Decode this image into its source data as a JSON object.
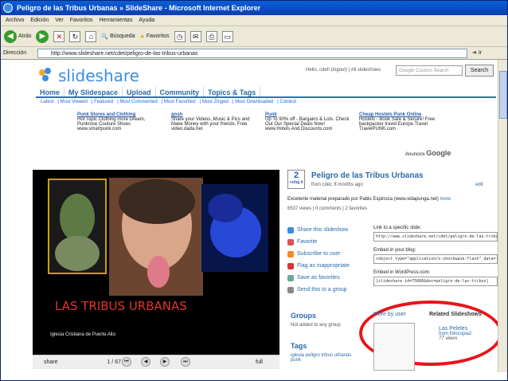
{
  "window": {
    "title": "Peligro de las Tribus Urbanas » SlideShare - Microsoft Internet Explorer"
  },
  "menu": [
    "Archivo",
    "Edición",
    "Ver",
    "Favoritos",
    "Herramientas",
    "Ayuda"
  ],
  "toolbar": {
    "back": "Atrás",
    "search": "Búsqueda",
    "favorites": "Favoritos"
  },
  "address": {
    "label": "Dirección",
    "url": "http://www.slideshare.net/cdet/peligro-de-las-tribus-urbanas",
    "go": "Ir"
  },
  "site": {
    "logo": "slideshare",
    "toplinks": "Hello, cdet! (logout) | All slideshows",
    "search_placeholder": "Google Custom Search",
    "search_button": "Search",
    "nav": [
      "Home",
      "My Slidespace",
      "Upload",
      "Community",
      "Topics & Tags"
    ],
    "subnav": [
      "Latest",
      "Most Viewed",
      "Featured",
      "Most Commented",
      "Most Favorited",
      "Most Zinged",
      "Most Downloaded",
      "Contest"
    ]
  },
  "ads": [
    {
      "title": "Punk Stores and Clothing",
      "text": "Hot Topic Clothing more Dream, Punkrose Couture Shoes",
      "url": "www.smartpunk.com"
    },
    {
      "title": "gosh",
      "text": "Share your Videos, Music & Pics and Make Money with your friends. Free",
      "url": "video.dada.net"
    },
    {
      "title": "Punk",
      "text": "Up To 90% off - Bargains & Lots. Check Out Our Special Deals Now!",
      "url": "www.Hotels And Discounts.com"
    },
    {
      "title": "Cheap Hostels Punk Online",
      "text": "Hostels - Book Safe & Secure! Free backpacker travel Europe Travel",
      "url": "TravelPUNK.com"
    }
  ],
  "ads_by": {
    "prefix": "Anuncios",
    "brand": "Google"
  },
  "video": {
    "title": "LAS TRIBUS URBANAS",
    "subtitle": "Iglesia Cristiana de Puerte Alto",
    "share": "share",
    "slide_counter": "1 / 67",
    "fullscreen": "full"
  },
  "info": {
    "zing_count": "2",
    "zing_label": "+zing it",
    "title": "Peligro de las Tribus Urbanas",
    "meta": "from cdet, 8 months ago",
    "edit": "edit",
    "description": "Excelente material preparado por Pablo Espinoza (www.vidapunga.net)",
    "more": "more",
    "views": "6537 views | 0 comments | 2 favorites",
    "actions": [
      "Share this slideshow",
      "Favorite",
      "Subscribe to user",
      "Flag as inappropriate",
      "Save as favorites",
      "Send this to a group"
    ],
    "link_label": "Link to a specific slide:",
    "link_value": "http://www.slideshare.net/cdet/peligro-de-las-tribus-urbanas",
    "embed_label": "Embed in your blog:",
    "embed_value": "<object type=\"application/x-shockwave-flash\" data=",
    "wp_label": "Embed in WordPress.com:",
    "wp_value": "[slideshare id=75086&doc=peligro-de-las-tribus]"
  },
  "groups": {
    "title": "Groups",
    "sub": "Not added to any group"
  },
  "tags": {
    "title": "Tags",
    "list": "iglesia peligro tribus urbanas punk"
  },
  "more_by_user": "More by user",
  "related": {
    "title": "Related Slideshows",
    "item": "Las Peleles",
    "from": "from fotocopia2",
    "views": "77 views"
  },
  "colors": {
    "accent": "#2a6aa8",
    "highlight_oval": "#e8141a",
    "video_title": "#e4332a"
  }
}
